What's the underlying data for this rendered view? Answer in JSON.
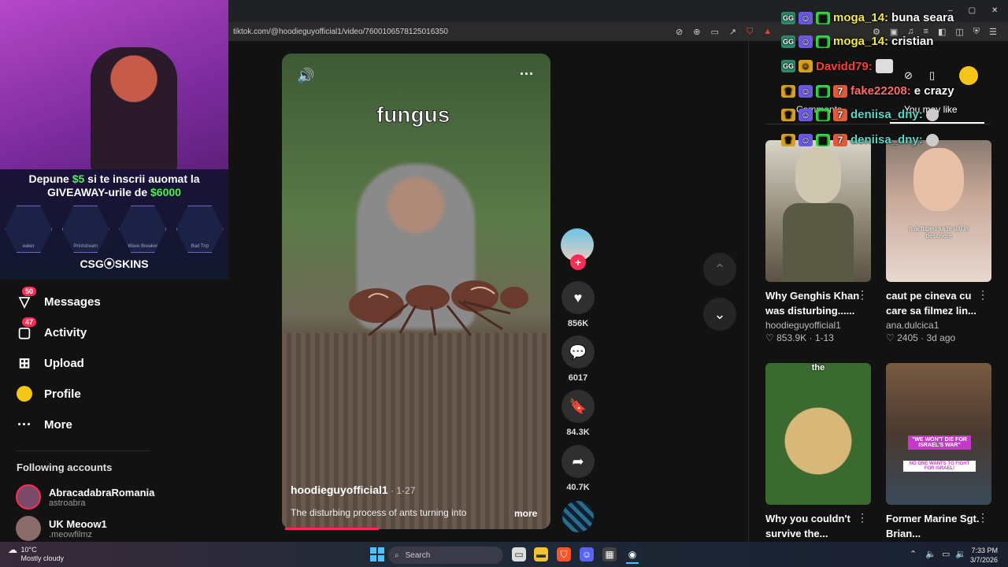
{
  "browser": {
    "url": "tiktok.com/@hoodieguyofficial1/video/7600106578125016350"
  },
  "stream_overlay": {
    "promo_line1": "Depune",
    "promo_amount1": "$5",
    "promo_line1b": "si te inscrii auomat la",
    "promo_line2": "GIVEAWAY-urile de",
    "promo_amount2": "$6000",
    "skins": [
      "eaker",
      "Printstream",
      "Wave Breaker",
      "Bad Trip"
    ],
    "brand": "CSG⦿SKINS"
  },
  "sidebar": {
    "items": [
      {
        "label": "Messages",
        "badge": "50",
        "icon": "messages-icon"
      },
      {
        "label": "Activity",
        "badge": "47",
        "icon": "activity-icon"
      },
      {
        "label": "Upload",
        "badge": "",
        "icon": "upload-icon"
      },
      {
        "label": "Profile",
        "badge": "",
        "icon": "profile-icon"
      },
      {
        "label": "More",
        "badge": "",
        "icon": "more-icon"
      }
    ],
    "following_title": "Following accounts",
    "accounts": [
      {
        "name": "AbracadabraRomania",
        "handle": "astroabra"
      },
      {
        "name": "UK Meoow1",
        "handle": ".meowfilmz"
      }
    ]
  },
  "video": {
    "overlay_text": "fungus",
    "author": "hoodieguyofficial1",
    "date": " · 1-27",
    "description": "The disturbing process of ants turning into",
    "more": "more",
    "likes": "856K",
    "comments": "6017",
    "saves": "84.3K",
    "shares": "40.7K",
    "progress": 0.35
  },
  "right_panel": {
    "tab_comments": "Comments",
    "tab_you_may_like": "You may like",
    "cards": [
      {
        "title": "Why Genghis Khan was disturbing......",
        "author": "hoodieguyofficial1",
        "likes": "853.9K",
        "date": "1-13"
      },
      {
        "title": "caut pe cineva cu care sa filmez lin...",
        "author": "ana.dulcica1",
        "likes": "2405",
        "date": "3d ago",
        "thumb_caption": "n ai tupeu sa te uiti in descriere"
      },
      {
        "title": "Why you couldn't survive the...",
        "thumb_caption": "the"
      },
      {
        "title": "Former Marine Sgt. Brian...",
        "thumb_caption": "\"WE WON'T DIE FOR ISRAEL'S WAR\"",
        "thumb_caption2": "NO ONE WANTS TO FIGHT FOR ISRAEL!"
      }
    ]
  },
  "chat": [
    {
      "user": "moga_14:",
      "msg": "buna seara",
      "color": "#f2e94a"
    },
    {
      "user": "moga_14:",
      "msg": "cristian",
      "color": "#f2e94a"
    },
    {
      "user": "Davidd79:",
      "msg": "",
      "color": "#ff3a3a"
    },
    {
      "user": "fake22208:",
      "msg": "e crazy",
      "color": "#ff6a6a"
    },
    {
      "user": "deniisa_dny:",
      "msg": "",
      "color": "#5ad8c8"
    },
    {
      "user": "deniisa_dny:",
      "msg": "",
      "color": "#5ad8c8"
    }
  ],
  "taskbar": {
    "weather_temp": "10°C",
    "weather_desc": "Mostly cloudy",
    "search_placeholder": "Search",
    "time": "7:33 PM",
    "date": "3/7/2026"
  }
}
